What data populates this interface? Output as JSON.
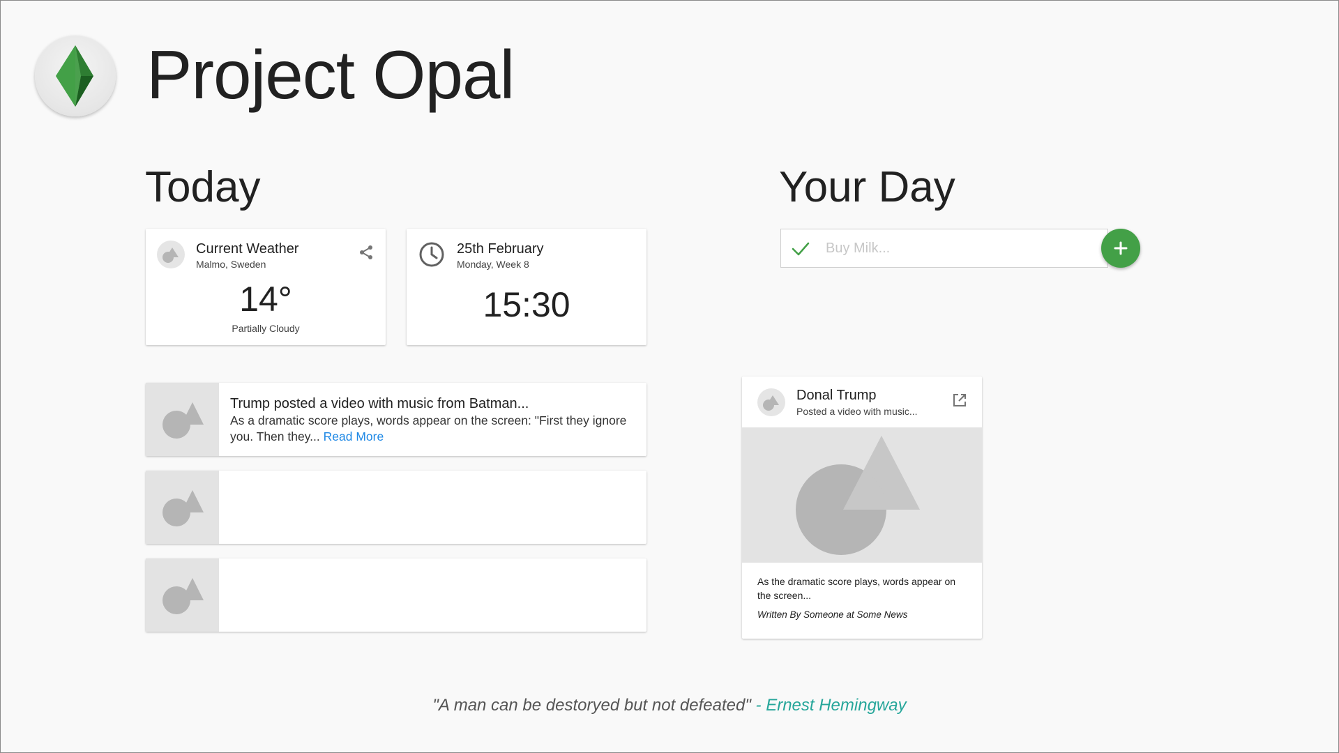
{
  "app": {
    "title": "Project Opal",
    "logo_icon": "green-diamond-gem-icon"
  },
  "today": {
    "heading": "Today",
    "weather": {
      "title": "Current Weather",
      "location": "Malmo, Sweden",
      "temperature": "14°",
      "condition": "Partially Cloudy",
      "avatar_icon": "placeholder-image-icon",
      "action_icon": "share-icon"
    },
    "date": {
      "title": "25th February",
      "subtitle": "Monday, Week 8",
      "time": "15:30",
      "icon": "clock-icon"
    },
    "news": [
      {
        "headline": "Trump posted a video with music from Batman...",
        "body": "As a dramatic score plays, words appear on the screen: \"First they ignore you. Then they...",
        "read_more": "Read More",
        "thumb_icon": "placeholder-image-icon"
      },
      {
        "headline": "",
        "body": "",
        "read_more": "",
        "thumb_icon": "placeholder-image-icon"
      },
      {
        "headline": "",
        "body": "",
        "read_more": "",
        "thumb_icon": "placeholder-image-icon"
      }
    ]
  },
  "your_day": {
    "heading": "Your Day",
    "todo_input": {
      "placeholder": "Buy Milk...",
      "value": "",
      "check_icon": "check-icon"
    },
    "add_button_icon": "plus-icon"
  },
  "article": {
    "title": "Donal Trump",
    "subtitle": "Posted a video with music...",
    "body": "As the dramatic score plays, words appear on the screen...",
    "byline": "Written By Someone at Some News",
    "action_icon": "open-in-new-icon",
    "media_icon": "placeholder-image-icon"
  },
  "quote": {
    "text": "\"A man can be destoryed but not defeated\"",
    "author": " - Ernest Hemingway"
  },
  "colors": {
    "background": "#f9f9f9",
    "accent_green": "#43a047",
    "link_blue": "#1e88e5",
    "quote_teal": "#26a69a",
    "placeholder_gray": "#b5b5b5"
  }
}
